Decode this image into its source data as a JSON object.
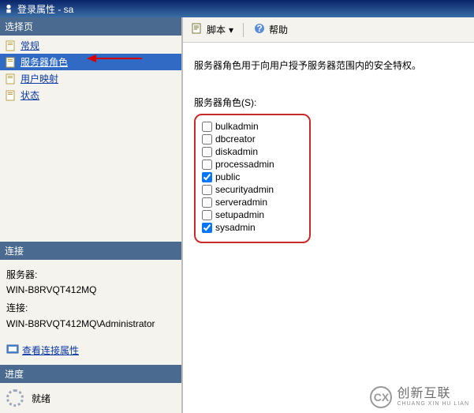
{
  "window": {
    "title": "登录属性 - sa"
  },
  "left": {
    "select_header": "选择页",
    "nav": [
      {
        "label": "常规",
        "selected": false
      },
      {
        "label": "服务器角色",
        "selected": true
      },
      {
        "label": "用户映射",
        "selected": false
      },
      {
        "label": "状态",
        "selected": false
      }
    ],
    "conn_header": "连接",
    "server_label": "服务器:",
    "server_value": "WIN-B8RVQT412MQ",
    "conn_label": "连接:",
    "conn_value": "WIN-B8RVQT412MQ\\Administrator",
    "view_conn_link": "查看连接属性",
    "progress_header": "进度",
    "ready": "就绪"
  },
  "right": {
    "toolbar": {
      "script": "脚本",
      "help": "帮助"
    },
    "description": "服务器角色用于向用户授予服务器范围内的安全特权。",
    "roles_label": "服务器角色(S):",
    "roles": [
      {
        "name": "bulkadmin",
        "checked": false
      },
      {
        "name": "dbcreator",
        "checked": false
      },
      {
        "name": "diskadmin",
        "checked": false
      },
      {
        "name": "processadmin",
        "checked": false
      },
      {
        "name": "public",
        "checked": true
      },
      {
        "name": "securityadmin",
        "checked": false
      },
      {
        "name": "serveradmin",
        "checked": false
      },
      {
        "name": "setupadmin",
        "checked": false
      },
      {
        "name": "sysadmin",
        "checked": true
      }
    ]
  },
  "watermark": {
    "brand": "创新互联",
    "sub": "CHUANG XIN HU LIAN"
  }
}
